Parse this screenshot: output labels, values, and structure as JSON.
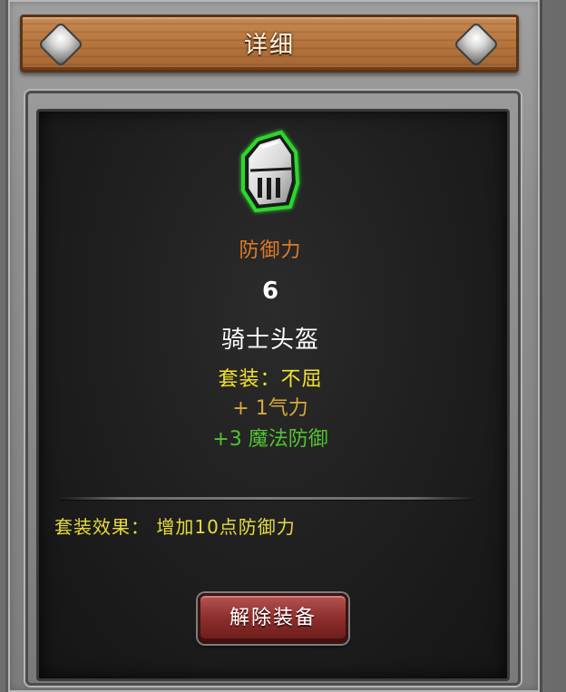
{
  "window": {
    "title": "详细"
  },
  "item": {
    "icon": "knight-helmet-icon",
    "stat_name": "防御力",
    "stat_value": "6",
    "name": "骑士头盔",
    "set_name": "套装：不屈",
    "bonus_1": "+ 1气力",
    "bonus_2": "+3 魔法防御"
  },
  "set_effect": {
    "text": "套装效果： 增加10点防御力"
  },
  "actions": {
    "unequip_label": "解除装备"
  },
  "colors": {
    "stat_name": "#e07a26",
    "set_name": "#f2e32a",
    "bonus_1": "#d8a93a",
    "bonus_2": "#52c234",
    "button": "#8c2e2c",
    "icon_glow": "#2fd62f"
  }
}
